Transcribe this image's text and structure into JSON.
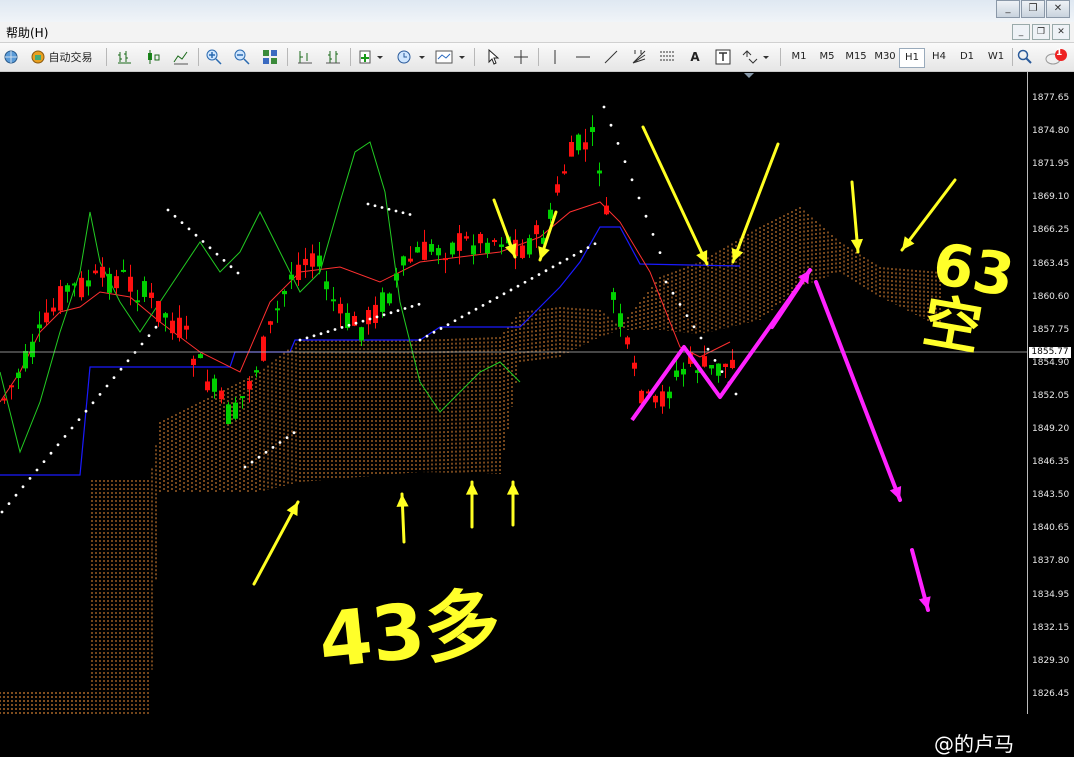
{
  "menu": {
    "help": "帮助(H)"
  },
  "window_controls": [
    "_",
    "❐",
    "✕"
  ],
  "mdi_controls": [
    "_",
    "❐",
    "✕"
  ],
  "toolbar": {
    "auto_trading": "自动交易",
    "icons": [
      "globe-icon",
      "auto-trading-icon",
      "bar-chart-icon",
      "candlestick-icon",
      "line-chart-icon",
      "zoom-in-icon",
      "zoom-out-icon",
      "tile-windows-icon",
      "chart-shift-icon",
      "autoscroll-icon",
      "indicators-icon",
      "periods-icon",
      "templates-icon",
      "cursor-icon",
      "crosshair-icon",
      "vertical-line-icon",
      "horizontal-line-icon",
      "trendline-icon",
      "fibonacci-fan-icon",
      "fibonacci-channel-icon",
      "text-icon",
      "text-label-icon",
      "arrows-icon",
      "search-icon",
      "alerts-icon"
    ],
    "text_tool": "A",
    "timeframes": [
      "M1",
      "M5",
      "M15",
      "M30",
      "H1",
      "H4",
      "D1",
      "W1"
    ],
    "active_timeframe": "H1",
    "notification_count": "1"
  },
  "price_axis": {
    "ticks": [
      "1877.65",
      "1874.80",
      "1871.95",
      "1869.10",
      "1866.25",
      "1863.45",
      "1860.60",
      "1857.75",
      "1854.90",
      "1852.05",
      "1849.20",
      "1846.35",
      "1843.50",
      "1840.65",
      "1837.80",
      "1834.95",
      "1832.15",
      "1829.30",
      "1826.45"
    ],
    "current_price": "1855.77"
  },
  "annotations": {
    "left_text": "43多",
    "right_text": "63空"
  },
  "watermark": "@的卢马",
  "colors": {
    "bull": "#00d000",
    "bear": "#ff1010",
    "kijun": "#1a1aff",
    "tenkan": "#ff3030",
    "chikou": "#22cc22",
    "cloud": "#ff9a3c",
    "psar": "#ffffff",
    "yellow_marks": "#ffff22",
    "magenta_marks": "#ff22ff"
  }
}
